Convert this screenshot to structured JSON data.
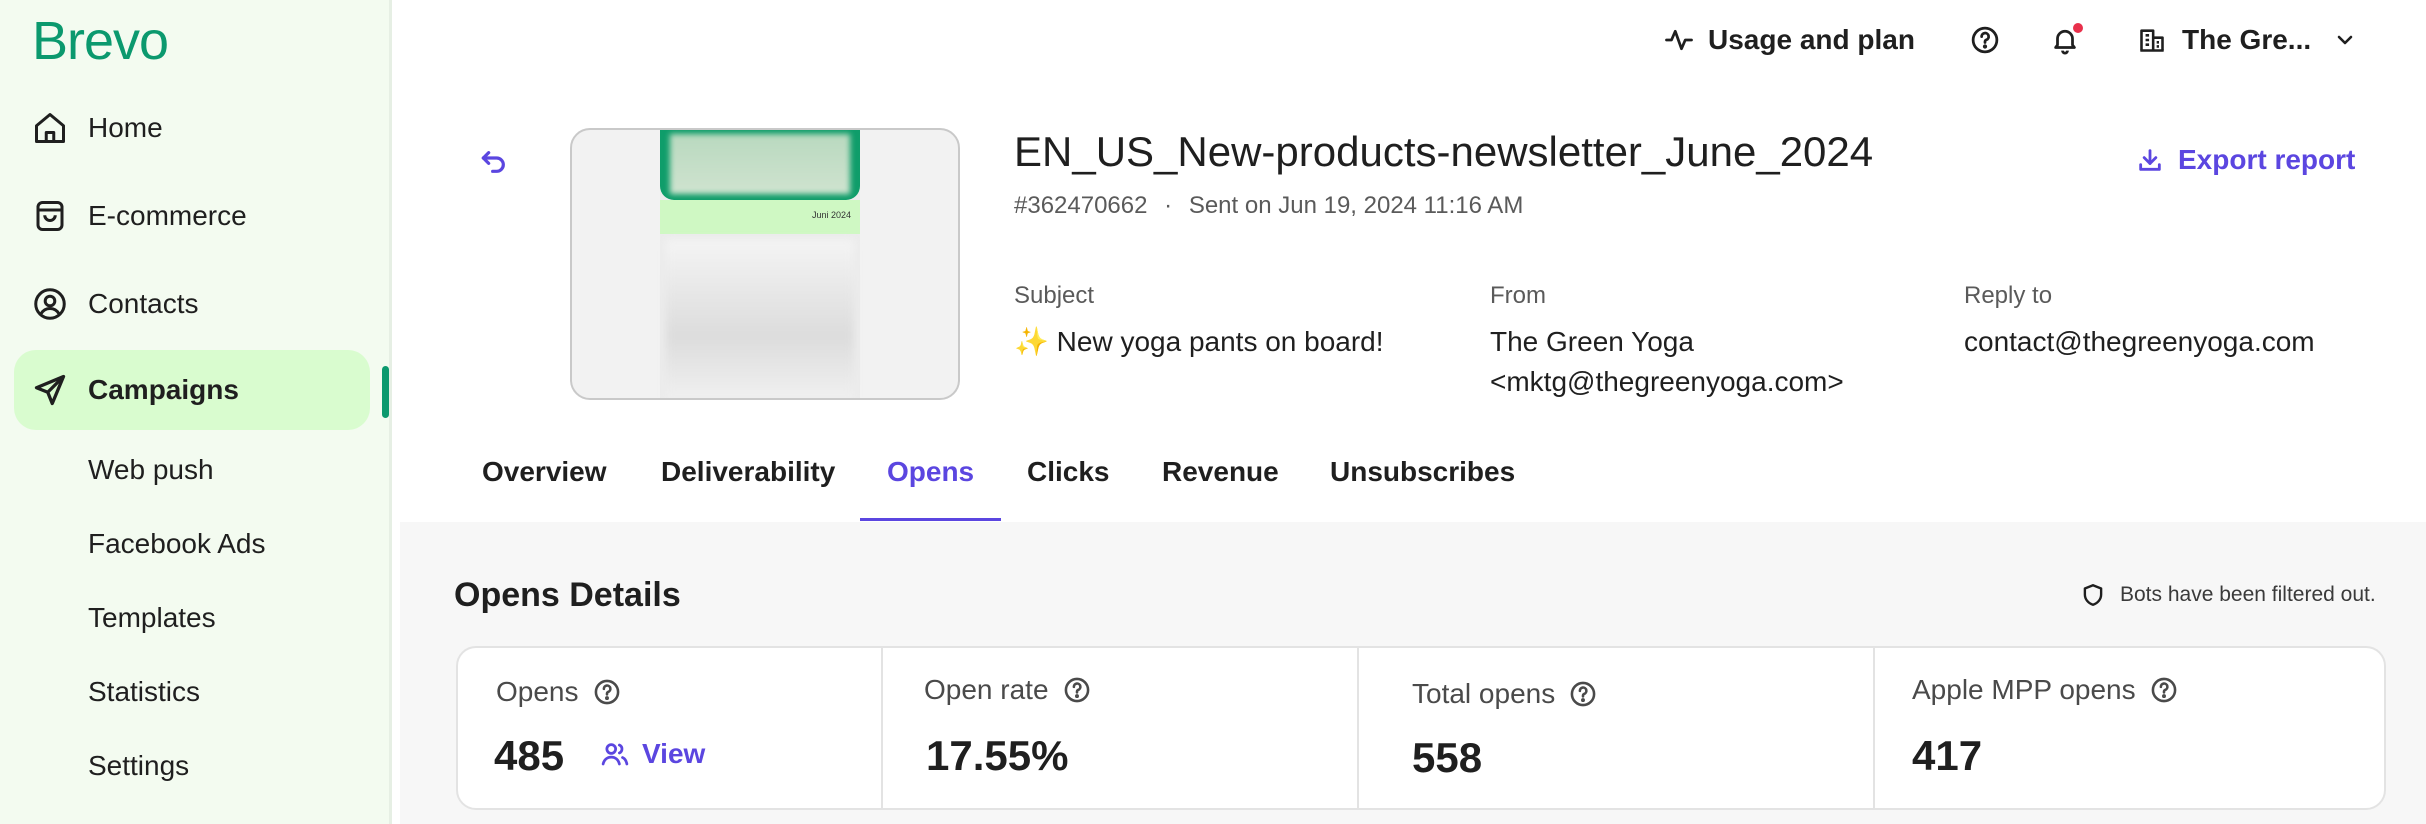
{
  "brand": {
    "logo": "Brevo"
  },
  "sidebar": {
    "items": [
      {
        "label": "Home",
        "icon": "home-icon"
      },
      {
        "label": "E-commerce",
        "icon": "shopping-bag-icon"
      },
      {
        "label": "Contacts",
        "icon": "user-circle-icon"
      },
      {
        "label": "Campaigns",
        "icon": "send-icon",
        "active": true
      }
    ],
    "sub_items": [
      "Web push",
      "Facebook Ads",
      "Templates",
      "Statistics",
      "Settings"
    ]
  },
  "topbar": {
    "usage_label": "Usage and plan",
    "account_name": "The Gre..."
  },
  "campaign": {
    "title": "EN_US_New-products-newsletter_June_2024",
    "id": "#362470662",
    "sent_on": "Sent on Jun 19, 2024 11:16 AM",
    "thumbnail_date": "Juni 2024",
    "export_label": "Export report",
    "subject_label": "Subject",
    "subject_emoji": "✨",
    "subject_value": "New yoga pants on board!",
    "from_label": "From",
    "from_name": "The Green Yoga",
    "from_email": "<mktg@thegreenyoga.com>",
    "reply_label": "Reply to",
    "reply_value": "contact@thegreenyoga.com"
  },
  "tabs": [
    {
      "label": "Overview"
    },
    {
      "label": "Deliverability"
    },
    {
      "label": "Opens",
      "active": true
    },
    {
      "label": "Clicks"
    },
    {
      "label": "Revenue"
    },
    {
      "label": "Unsubscribes"
    }
  ],
  "opens_details": {
    "title": "Opens Details",
    "bots_note": "Bots have been filtered out.",
    "view_label": "View",
    "stats": [
      {
        "label": "Opens",
        "value": "485"
      },
      {
        "label": "Open rate",
        "value": "17.55%"
      },
      {
        "label": "Total opens",
        "value": "558"
      },
      {
        "label": "Apple MPP opens",
        "value": "417"
      }
    ]
  },
  "colors": {
    "brand_green": "#0b996e",
    "active_bg": "#d9fccf",
    "accent_purple": "#5b46e0",
    "notification_red": "#e8304b"
  }
}
